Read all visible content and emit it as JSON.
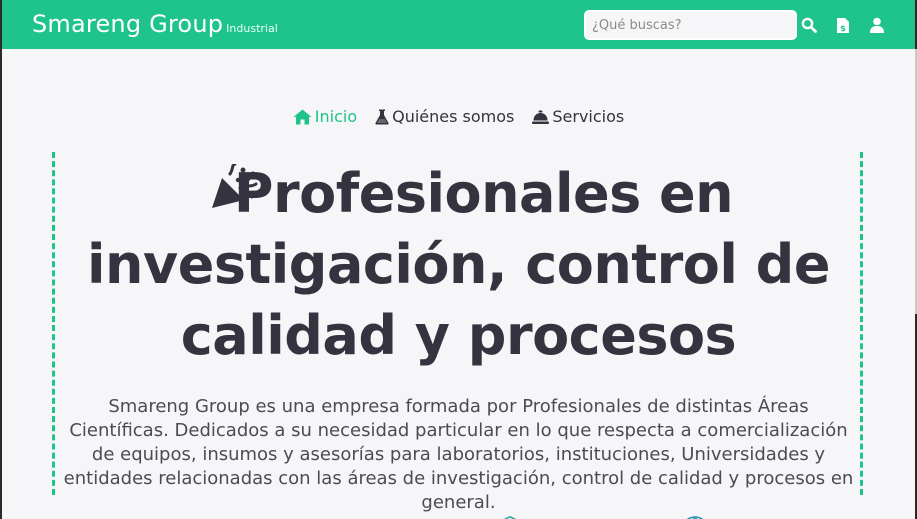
{
  "brand": {
    "name": "Smareng Group",
    "tagline": "Industrial"
  },
  "search": {
    "placeholder": "¿Qué buscas?"
  },
  "header_icons": [
    "search-icon",
    "invoice-icon",
    "user-icon"
  ],
  "nav": {
    "items": [
      {
        "label": "Inicio",
        "icon": "home-icon",
        "active": true
      },
      {
        "label": "Quiénes somos",
        "icon": "flask-icon",
        "active": false
      },
      {
        "label": "Servicios",
        "icon": "concierge-bell-icon",
        "active": false
      }
    ]
  },
  "hero": {
    "icon": "party-popper-icon",
    "title": "Profesionales en investigación, control de calidad y procesos",
    "description": "Smareng Group es una empresa formada por Profesionales de distintas Áreas Científicas. Dedicados a su necesidad particular en lo que respecta a comercialización de equipos, insumos y asesorías para laboratorios, instituciones, Universidades y entidades relacionadas con las áreas de investigación, control de calidad y procesos en general."
  },
  "colors": {
    "accent": "#1fc48d",
    "text": "#34333f",
    "background": "#f6f6f8"
  }
}
